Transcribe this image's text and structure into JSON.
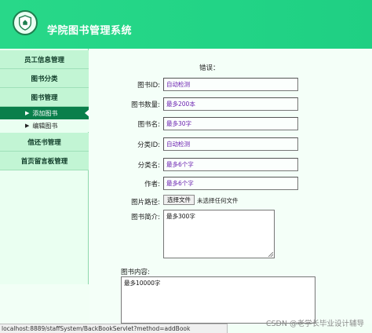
{
  "header": {
    "title": "学院图书管理系统",
    "logo_icon": "shield-badge-icon"
  },
  "sidebar": {
    "items": [
      {
        "label": "员工信息管理"
      },
      {
        "label": "图书分类"
      },
      {
        "label": "图书管理"
      },
      {
        "label": "借还书管理"
      },
      {
        "label": "首页留言板管理"
      }
    ],
    "subitems": [
      {
        "label": "添加图书",
        "active": true
      },
      {
        "label": "编辑图书",
        "active": false
      }
    ]
  },
  "form": {
    "error_label": "错误：",
    "fields": [
      {
        "label": "图书ID:",
        "value": "自动检测"
      },
      {
        "label": "图书数量:",
        "value": "最多200本"
      },
      {
        "label": "图书名:",
        "value": "最多30字"
      },
      {
        "label": "分类ID:",
        "value": "自动检测"
      },
      {
        "label": "分类名:",
        "value": "最多6个字"
      },
      {
        "label": "作者:",
        "value": "最多6个字"
      }
    ],
    "image_path": {
      "label": "图片路径:",
      "button": "选择文件",
      "status": "未选择任何文件"
    },
    "intro": {
      "label": "图书简介:",
      "value": "最多300字"
    },
    "content": {
      "label": "图书内容:",
      "value": "最多10000字"
    }
  },
  "statusbar": {
    "url": "localhost:8889/staffSystem/BackBookServlet?method=addBook"
  },
  "watermark": "CSDN @老学长毕业设计辅导",
  "colors": {
    "header": "#22d486",
    "menu": "#c2f5d4",
    "active": "#0a7f4b",
    "field_text": "#6a1fb0"
  }
}
